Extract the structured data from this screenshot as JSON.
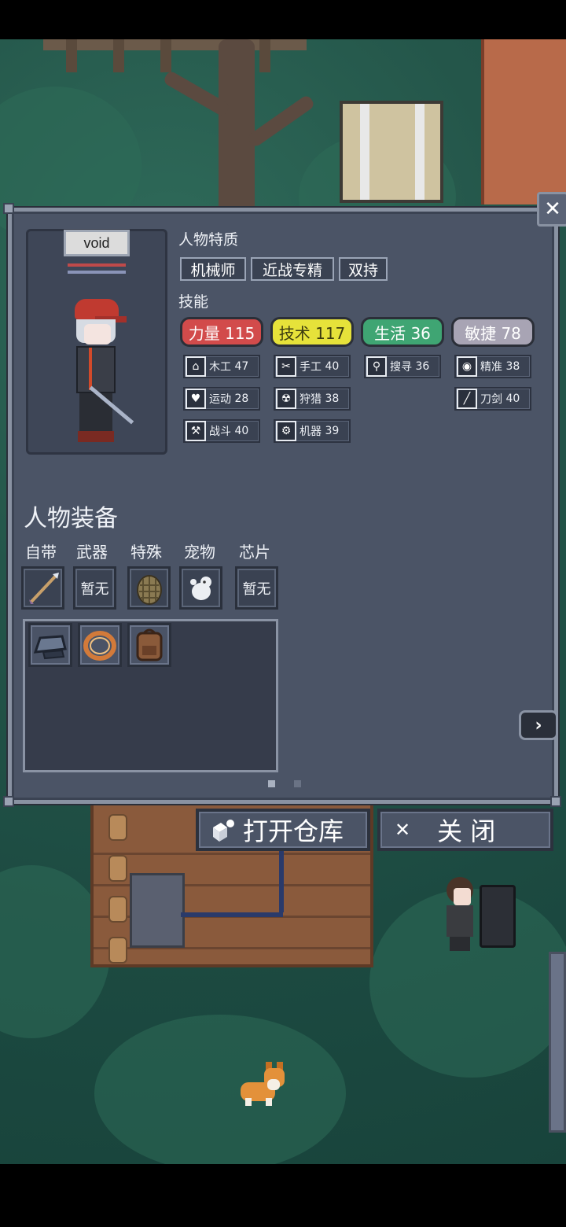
{
  "character": {
    "name": "void",
    "bar_colors": [
      "#c04a4a",
      "#8a94b8"
    ]
  },
  "traits_label": "人物特质",
  "traits": [
    "机械师",
    "近战专精",
    "双持"
  ],
  "skills_label": "技能",
  "stats": [
    {
      "text": "力量 115",
      "color": "#d24b4b"
    },
    {
      "text": "技术 117",
      "color": "#e6e23a"
    },
    {
      "text": "生活 36",
      "color": "#3fa573"
    },
    {
      "text": "敏捷 78",
      "color": "#a8a4b4"
    }
  ],
  "skills": [
    {
      "name": "木工",
      "level": "47",
      "icon": "house-icon",
      "glyph": "⌂"
    },
    {
      "name": "手工",
      "level": "40",
      "icon": "scissors-icon",
      "glyph": "✂"
    },
    {
      "name": "搜寻",
      "level": "36",
      "icon": "magnifier-icon",
      "glyph": "⚲"
    },
    {
      "name": "精准",
      "level": "38",
      "icon": "eye-icon",
      "glyph": "◉"
    },
    {
      "name": "运动",
      "level": "28",
      "icon": "heart-icon",
      "glyph": "♥"
    },
    {
      "name": "狩猎",
      "level": "38",
      "icon": "radiation-icon",
      "glyph": "☢"
    },
    {
      "name": "刀剑",
      "level": "40",
      "icon": "blade-icon",
      "glyph": "╱"
    },
    {
      "name": "战斗",
      "level": "40",
      "icon": "wrench-icon",
      "glyph": "⚒"
    },
    {
      "name": "机器",
      "level": "39",
      "icon": "gear-icon",
      "glyph": "⚙"
    }
  ],
  "equipment_title": "人物装备",
  "equipment_slots": [
    {
      "label": "自带",
      "value": "",
      "icon": "spear-icon"
    },
    {
      "label": "武器",
      "value": "暂无",
      "icon": ""
    },
    {
      "label": "特殊",
      "value": "",
      "icon": "grenade-icon"
    },
    {
      "label": "宠物",
      "value": "",
      "icon": "pet-icon"
    },
    {
      "label": "芯片",
      "value": "暂无",
      "icon": ""
    }
  ],
  "inventory": [
    {
      "icon": "armor-plate-icon"
    },
    {
      "icon": "ring-icon"
    },
    {
      "icon": "backpack-icon"
    }
  ],
  "page_dots": 2,
  "active_page": 0,
  "buttons": {
    "open_storage": "打开仓库",
    "open_storage_icon": "crate-icon",
    "close": "关 闭",
    "close_icon": "close-icon"
  },
  "close_glyph": "✕"
}
